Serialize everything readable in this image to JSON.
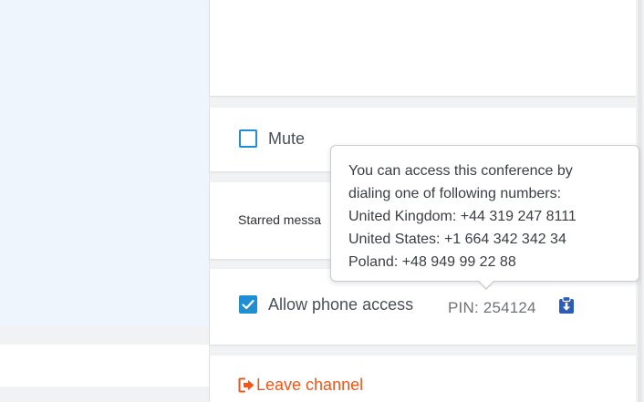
{
  "settings": {
    "mute": {
      "label": "Mute",
      "checked": false
    },
    "starred": {
      "label": "Starred messa"
    },
    "phone_access": {
      "label": "Allow phone access",
      "checked": true,
      "pin": "PIN: 254124"
    },
    "leave": {
      "label": "Leave channel"
    }
  },
  "tooltip": {
    "lines": [
      "You can access this conference by",
      "dialing one of following numbers:",
      "United Kingdom: +44 319 247 8111",
      "United States: +1 664 342 342 34",
      "Poland: +48 949 99 22 88"
    ]
  },
  "icons": {
    "checkmark": "check-icon",
    "clipboard": "clipboard-download-icon",
    "leave": "sign-out-icon"
  },
  "colors": {
    "accent": "#1f8fd1",
    "leave": "#f0561a",
    "left_panel": "#eef5fd",
    "gap": "#f1f2f4"
  }
}
